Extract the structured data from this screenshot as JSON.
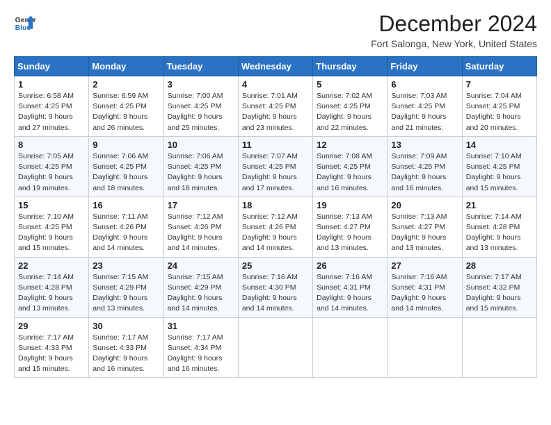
{
  "header": {
    "logo_line1": "General",
    "logo_line2": "Blue",
    "month_title": "December 2024",
    "location": "Fort Salonga, New York, United States"
  },
  "days_of_week": [
    "Sunday",
    "Monday",
    "Tuesday",
    "Wednesday",
    "Thursday",
    "Friday",
    "Saturday"
  ],
  "weeks": [
    [
      {
        "day": 1,
        "sunrise": "6:58 AM",
        "sunset": "4:25 PM",
        "daylight": "9 hours and 27 minutes."
      },
      {
        "day": 2,
        "sunrise": "6:59 AM",
        "sunset": "4:25 PM",
        "daylight": "9 hours and 26 minutes."
      },
      {
        "day": 3,
        "sunrise": "7:00 AM",
        "sunset": "4:25 PM",
        "daylight": "9 hours and 25 minutes."
      },
      {
        "day": 4,
        "sunrise": "7:01 AM",
        "sunset": "4:25 PM",
        "daylight": "9 hours and 23 minutes."
      },
      {
        "day": 5,
        "sunrise": "7:02 AM",
        "sunset": "4:25 PM",
        "daylight": "9 hours and 22 minutes."
      },
      {
        "day": 6,
        "sunrise": "7:03 AM",
        "sunset": "4:25 PM",
        "daylight": "9 hours and 21 minutes."
      },
      {
        "day": 7,
        "sunrise": "7:04 AM",
        "sunset": "4:25 PM",
        "daylight": "9 hours and 20 minutes."
      }
    ],
    [
      {
        "day": 8,
        "sunrise": "7:05 AM",
        "sunset": "4:25 PM",
        "daylight": "9 hours and 19 minutes."
      },
      {
        "day": 9,
        "sunrise": "7:06 AM",
        "sunset": "4:25 PM",
        "daylight": "9 hours and 18 minutes."
      },
      {
        "day": 10,
        "sunrise": "7:06 AM",
        "sunset": "4:25 PM",
        "daylight": "9 hours and 18 minutes."
      },
      {
        "day": 11,
        "sunrise": "7:07 AM",
        "sunset": "4:25 PM",
        "daylight": "9 hours and 17 minutes."
      },
      {
        "day": 12,
        "sunrise": "7:08 AM",
        "sunset": "4:25 PM",
        "daylight": "9 hours and 16 minutes."
      },
      {
        "day": 13,
        "sunrise": "7:09 AM",
        "sunset": "4:25 PM",
        "daylight": "9 hours and 16 minutes."
      },
      {
        "day": 14,
        "sunrise": "7:10 AM",
        "sunset": "4:25 PM",
        "daylight": "9 hours and 15 minutes."
      }
    ],
    [
      {
        "day": 15,
        "sunrise": "7:10 AM",
        "sunset": "4:25 PM",
        "daylight": "9 hours and 15 minutes."
      },
      {
        "day": 16,
        "sunrise": "7:11 AM",
        "sunset": "4:26 PM",
        "daylight": "9 hours and 14 minutes."
      },
      {
        "day": 17,
        "sunrise": "7:12 AM",
        "sunset": "4:26 PM",
        "daylight": "9 hours and 14 minutes."
      },
      {
        "day": 18,
        "sunrise": "7:12 AM",
        "sunset": "4:26 PM",
        "daylight": "9 hours and 14 minutes."
      },
      {
        "day": 19,
        "sunrise": "7:13 AM",
        "sunset": "4:27 PM",
        "daylight": "9 hours and 13 minutes."
      },
      {
        "day": 20,
        "sunrise": "7:13 AM",
        "sunset": "4:27 PM",
        "daylight": "9 hours and 13 minutes."
      },
      {
        "day": 21,
        "sunrise": "7:14 AM",
        "sunset": "4:28 PM",
        "daylight": "9 hours and 13 minutes."
      }
    ],
    [
      {
        "day": 22,
        "sunrise": "7:14 AM",
        "sunset": "4:28 PM",
        "daylight": "9 hours and 13 minutes."
      },
      {
        "day": 23,
        "sunrise": "7:15 AM",
        "sunset": "4:29 PM",
        "daylight": "9 hours and 13 minutes."
      },
      {
        "day": 24,
        "sunrise": "7:15 AM",
        "sunset": "4:29 PM",
        "daylight": "9 hours and 14 minutes."
      },
      {
        "day": 25,
        "sunrise": "7:16 AM",
        "sunset": "4:30 PM",
        "daylight": "9 hours and 14 minutes."
      },
      {
        "day": 26,
        "sunrise": "7:16 AM",
        "sunset": "4:31 PM",
        "daylight": "9 hours and 14 minutes."
      },
      {
        "day": 27,
        "sunrise": "7:16 AM",
        "sunset": "4:31 PM",
        "daylight": "9 hours and 14 minutes."
      },
      {
        "day": 28,
        "sunrise": "7:17 AM",
        "sunset": "4:32 PM",
        "daylight": "9 hours and 15 minutes."
      }
    ],
    [
      {
        "day": 29,
        "sunrise": "7:17 AM",
        "sunset": "4:33 PM",
        "daylight": "9 hours and 15 minutes."
      },
      {
        "day": 30,
        "sunrise": "7:17 AM",
        "sunset": "4:33 PM",
        "daylight": "9 hours and 16 minutes."
      },
      {
        "day": 31,
        "sunrise": "7:17 AM",
        "sunset": "4:34 PM",
        "daylight": "9 hours and 16 minutes."
      },
      null,
      null,
      null,
      null
    ]
  ]
}
